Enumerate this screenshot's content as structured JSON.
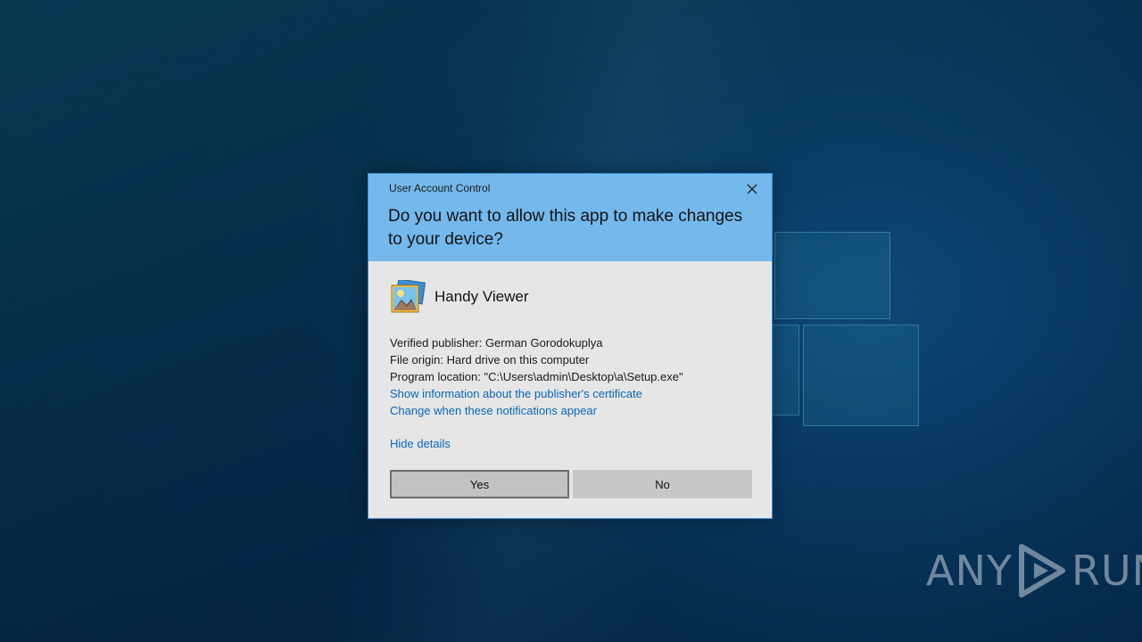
{
  "dialog": {
    "caption": "User Account Control",
    "question": "Do you want to allow this app to make changes to your device?",
    "app_name": "Handy Viewer",
    "details": {
      "publisher": "Verified publisher: German Gorodokuplya",
      "origin": "File origin: Hard drive on this computer",
      "location": "Program location: \"C:\\Users\\admin\\Desktop\\a\\Setup.exe\""
    },
    "links": {
      "certificate": "Show information about the publisher's certificate",
      "notifications": "Change when these notifications appear",
      "hide_details": "Hide details"
    },
    "buttons": {
      "yes": "Yes",
      "no": "No"
    }
  },
  "watermark": {
    "left": "ANY",
    "right": "RUN"
  },
  "colors": {
    "header": "#74b8ec",
    "body": "#e6e6e6",
    "link": "#0b66b8",
    "border": "#3b8fd6"
  },
  "icons": {
    "close": "close-icon",
    "app": "image-viewer-icon",
    "watermark": "play-icon"
  }
}
